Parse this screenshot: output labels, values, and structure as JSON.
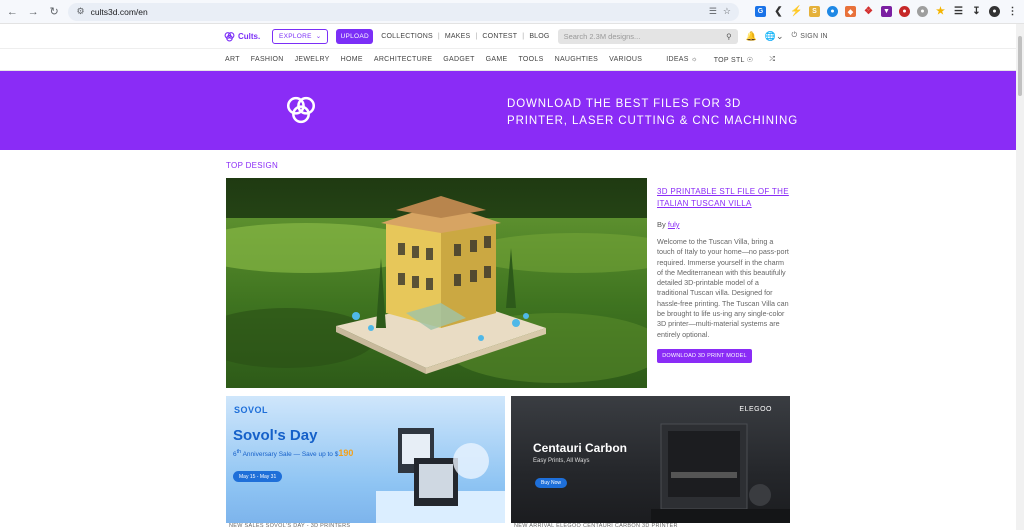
{
  "browser": {
    "url": "cults3d.com/en"
  },
  "header": {
    "logo_text": "Cults.",
    "explore_label": "EXPLORE",
    "upload_label": "UPLOAD",
    "links": [
      "COLLECTIONS",
      "MAKES",
      "CONTEST",
      "BLOG"
    ],
    "search_placeholder": "Search 2.3M designs...",
    "signin_label": "SIGN IN"
  },
  "categories": [
    "ART",
    "FASHION",
    "JEWELRY",
    "HOME",
    "ARCHITECTURE",
    "GADGET",
    "GAME",
    "TOOLS",
    "NAUGHTIES",
    "VARIOUS"
  ],
  "categories_extra": {
    "ideas": "IDEAS",
    "top_stl": "TOP STL"
  },
  "banner": {
    "line1": "DOWNLOAD THE BEST FILES FOR 3D",
    "line2": "PRINTER, LASER CUTTING & CNC MACHINING"
  },
  "top_design": {
    "section_title": "TOP DESIGN",
    "title_line1": "3D PRINTABLE STL FILE OF THE",
    "title_line2": "ITALIAN TUSCAN VILLA",
    "by_label": "By",
    "author": "fuly",
    "description": "Welcome to the Tuscan Villa, bring a touch of Italy to your home—no pass-port required. Immerse yourself in the charm of the Mediterranean with this beautifully detailed 3D-printable model of a traditional Tuscan villa. Designed for hassle-free printing. The Tuscan Villa can be brought to life us-ing any single-color 3D printer—multi-material systems are entirely optional.",
    "download_label": "DOWNLOAD 3D PRINT MODEL"
  },
  "ads": [
    {
      "brand": "SOVOL",
      "headline": "Sovol's Day",
      "subline_prefix": "6",
      "subline_sup": "th",
      "subline": " Anniversary Sale — Save up to $",
      "subline_amount": "190",
      "dates": "May 15 - May 31",
      "caption": "NEW SALES SOVOL'S DAY - 3D PRINTERS"
    },
    {
      "brand": "ELEGOO",
      "headline": "Centauri Carbon",
      "subline": "Easy Prints, All Ways",
      "cta": "Buy Now",
      "caption": "NEW ARRIVAL ELEGOO CENTAURI CARBON 3D PRINTER"
    }
  ],
  "colors": {
    "brand_purple": "#8a2cf6",
    "banner": "#8a2cf6"
  }
}
